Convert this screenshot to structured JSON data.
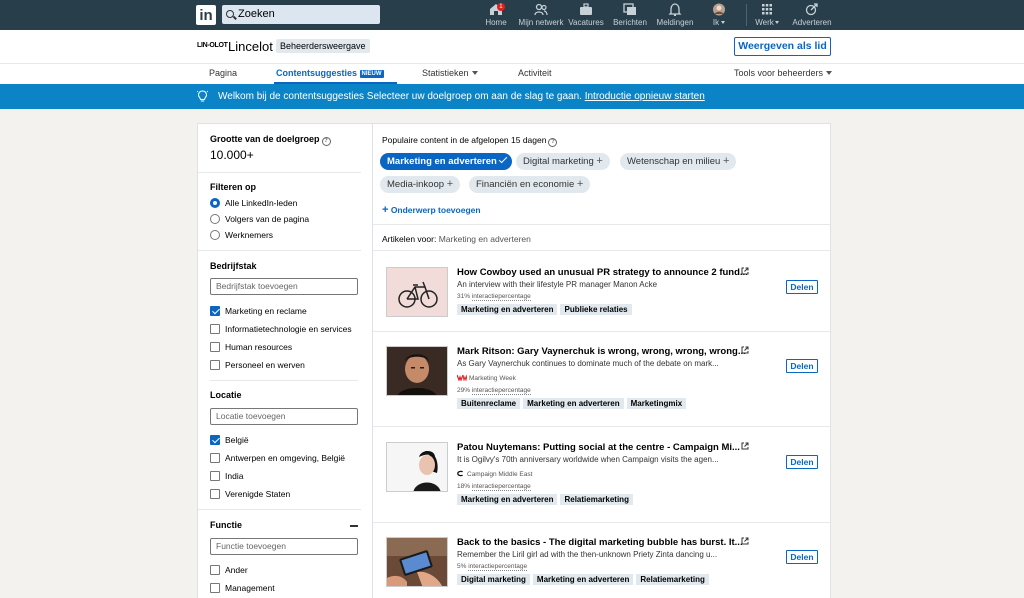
{
  "nav": {
    "logo": "in",
    "search_placeholder": "Zoeken",
    "items": [
      {
        "label": "Home",
        "icon": "home-icon",
        "badge": "1"
      },
      {
        "label": "Mijn netwerk",
        "icon": "network-icon"
      },
      {
        "label": "Vacatures",
        "icon": "briefcase-icon"
      },
      {
        "label": "Berichten",
        "icon": "messaging-icon"
      },
      {
        "label": "Meldingen",
        "icon": "bell-icon"
      },
      {
        "label": "Ik",
        "icon": "avatar"
      },
      {
        "label": "Werk",
        "icon": "grid-icon"
      },
      {
        "label": "Adverteren",
        "icon": "ad-icon"
      }
    ]
  },
  "company": {
    "logo_text": "LIN-OLOT",
    "name": "Lincelot",
    "badge": "Beheerdersweergave",
    "view_button": "Weergeven als lid"
  },
  "tabs": {
    "pagina": "Pagina",
    "content": "Contentsuggesties",
    "content_badge": "NIEUW",
    "stats": "Statistieken",
    "activity": "Activiteit",
    "admin_tools": "Tools voor beheerders"
  },
  "banner": {
    "text": "Welkom bij de contentsuggesties Selecteer uw doelgroep om aan de slag te gaan.",
    "link": "Introductie opnieuw starten"
  },
  "filters": {
    "audience_title": "Grootte van de doelgroep",
    "audience_value": "10.000+",
    "filter_title": "Filteren op",
    "filter_options": [
      "Alle LinkedIn-leden",
      "Volgers van de pagina",
      "Werknemers"
    ],
    "industry_title": "Bedrijfstak",
    "industry_placeholder": "Bedrijfstak toevoegen",
    "industries": [
      "Marketing en reclame",
      "Informatietechnologie en services",
      "Human resources",
      "Personeel en werven"
    ],
    "location_title": "Locatie",
    "location_placeholder": "Locatie toevoegen",
    "locations": [
      "België",
      "Antwerpen en omgeving, België",
      "India",
      "Verenigde Staten"
    ],
    "function_title": "Functie",
    "function_placeholder": "Functie toevoegen",
    "functions": [
      "Ander",
      "Management"
    ]
  },
  "main": {
    "popular_title": "Populaire content in de afgelopen 15 dagen",
    "topics": [
      "Marketing en adverteren",
      "Digital marketing",
      "Wetenschap en milieu",
      "Media-inkoop",
      "Financiën en economie"
    ],
    "add_topic": "Onderwerp toevoegen",
    "articles_label": "Artikelen voor:",
    "articles_topic": "Marketing en adverteren",
    "share_label": "Delen",
    "rate_label": "interactiepercentage",
    "articles": [
      {
        "title": "How Cowboy used an unusual PR strategy to announce 2 fund...",
        "subtitle": "An interview with their lifestyle PR manager Manon Acke",
        "source": "",
        "rate": "31%",
        "tags": [
          "Marketing en adverteren",
          "Publieke relaties"
        ]
      },
      {
        "title": "Mark Ritson: Gary Vaynerchuk is wrong, wrong, wrong, wrong...",
        "subtitle": "As Gary Vaynerchuk continues to dominate much of the debate on mark...",
        "source": "Marketing Week",
        "rate": "29%",
        "tags": [
          "Buitenreclame",
          "Marketing en adverteren",
          "Marketingmix"
        ]
      },
      {
        "title": "Patou Nuytemans: Putting social at the centre - Campaign Mi...",
        "subtitle": "It is Ogilvy's 70th anniversary worldwide when Campaign visits the agen...",
        "source": "Campaign Middle East",
        "rate": "18%",
        "tags": [
          "Marketing en adverteren",
          "Relatiemarketing"
        ]
      },
      {
        "title": "Back to the basics - The digital marketing bubble has burst. It...",
        "subtitle": "Remember the Liril girl ad with the then-unknown Priety Zinta dancing u...",
        "source": "",
        "rate": "5%",
        "tags": [
          "Digital marketing",
          "Marketing en adverteren",
          "Relatiemarketing"
        ]
      }
    ]
  },
  "colors": {
    "nav_bg": "#283e4a",
    "primary": "#0a66c2",
    "banner": "#0a84c7",
    "page_bg": "#f3f2ef"
  }
}
